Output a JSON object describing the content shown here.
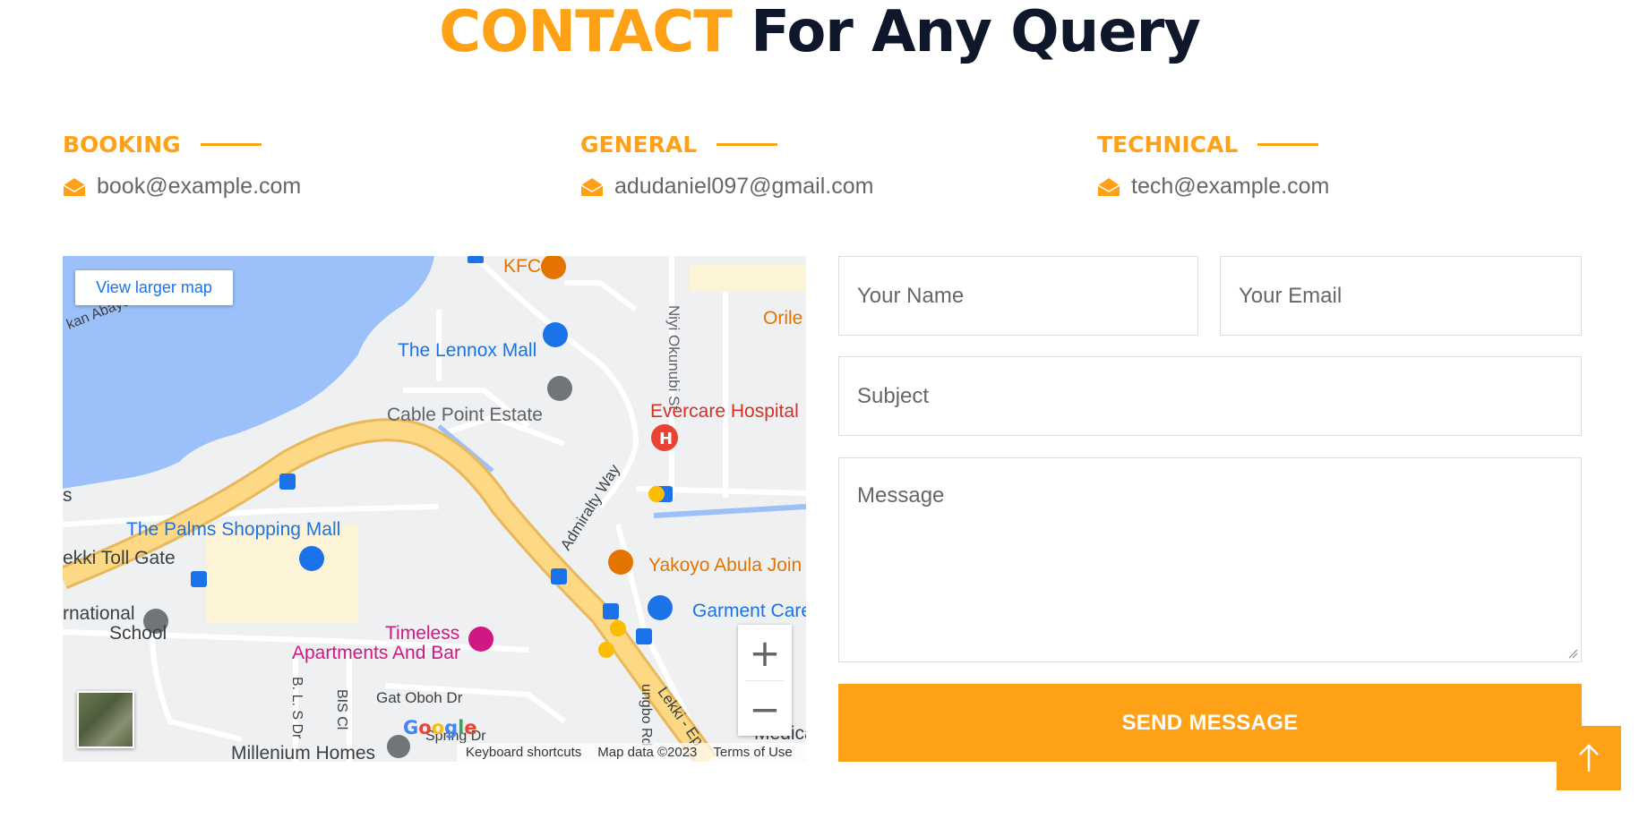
{
  "header": {
    "title_accent": "CONTACT",
    "title_rest": " For Any Query"
  },
  "contacts": [
    {
      "label": "BOOKING",
      "email": "book@example.com"
    },
    {
      "label": "GENERAL",
      "email": "adudaniel097@gmail.com"
    },
    {
      "label": "TECHNICAL",
      "email": "tech@example.com"
    }
  ],
  "map": {
    "larger_map_link": "View larger map",
    "zoom_in": "+",
    "zoom_out": "−",
    "footer": {
      "shortcuts": "Keyboard shortcuts",
      "data": "Map data ©2023",
      "terms": "Terms of Use"
    },
    "google_logo": "Google",
    "labels": {
      "kfc": "KFC",
      "orile": "Orile",
      "niyi": "Niyi Okunubi St",
      "lennox": "The Lennox Mall",
      "cable": "Cable Point Estate",
      "evercare": "Evercare Hospital",
      "admiralty": "Admiralty Way",
      "palms": "The Palms Shopping Mall",
      "tollgate": "ekki Toll Gate",
      "yakoyo": "Yakoyo Abula Join",
      "garment": "Garment Care",
      "intl1": "rnational",
      "intl2": "School",
      "timeless1": "Timeless",
      "timeless2": "Apartments And Bar",
      "gatoboh": "Gat Oboh Dr",
      "bls": "B. L. S Dr",
      "bis": "BIS Cl",
      "ungbo": "ungbo Rd",
      "spring": "Spring Dr",
      "lekki": "Lekki - Ep",
      "medical": "Medical",
      "millenium": "Millenium Homes",
      "abayomi": "kan Abayomi",
      "s": "s"
    },
    "colors": {
      "water": "#9cc0f9",
      "road": "#fdd885",
      "land": "#eef0f2",
      "poi_blue": "#1a73e8",
      "poi_red": "#d93025",
      "poi_orange": "#e37400",
      "poi_pink": "#d01884"
    }
  },
  "form": {
    "name_placeholder": "Your Name",
    "email_placeholder": "Your Email",
    "subject_placeholder": "Subject",
    "message_placeholder": "Message",
    "submit_label": "SEND MESSAGE"
  },
  "back_to_top": {
    "icon": "arrow-up-icon"
  },
  "colors": {
    "accent": "#fea116",
    "dark": "#0f172b",
    "text": "#666666",
    "border": "#dddddd"
  }
}
